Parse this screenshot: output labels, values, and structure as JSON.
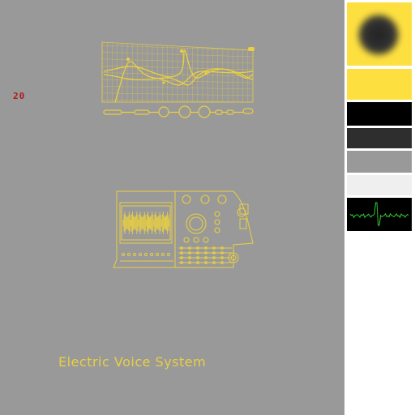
{
  "counter": {
    "value": "20"
  },
  "brand": {
    "text": "Electric Voice System"
  },
  "colors": {
    "accent": "#e9cf42",
    "canvas": "#999999",
    "counter": "#b01a1a",
    "scope_line": "#32c832",
    "swatches": [
      "#fde040",
      "#fde040",
      "#000000",
      "#2e2e2e",
      "#999999",
      "#efefef",
      "#000000"
    ]
  },
  "icons": {
    "eq_panel": "equalizer-panel-icon",
    "mixer_panel": "mixer-console-icon",
    "glow": "dark-glow-spot-icon",
    "scope": "waveform-scope-icon"
  }
}
